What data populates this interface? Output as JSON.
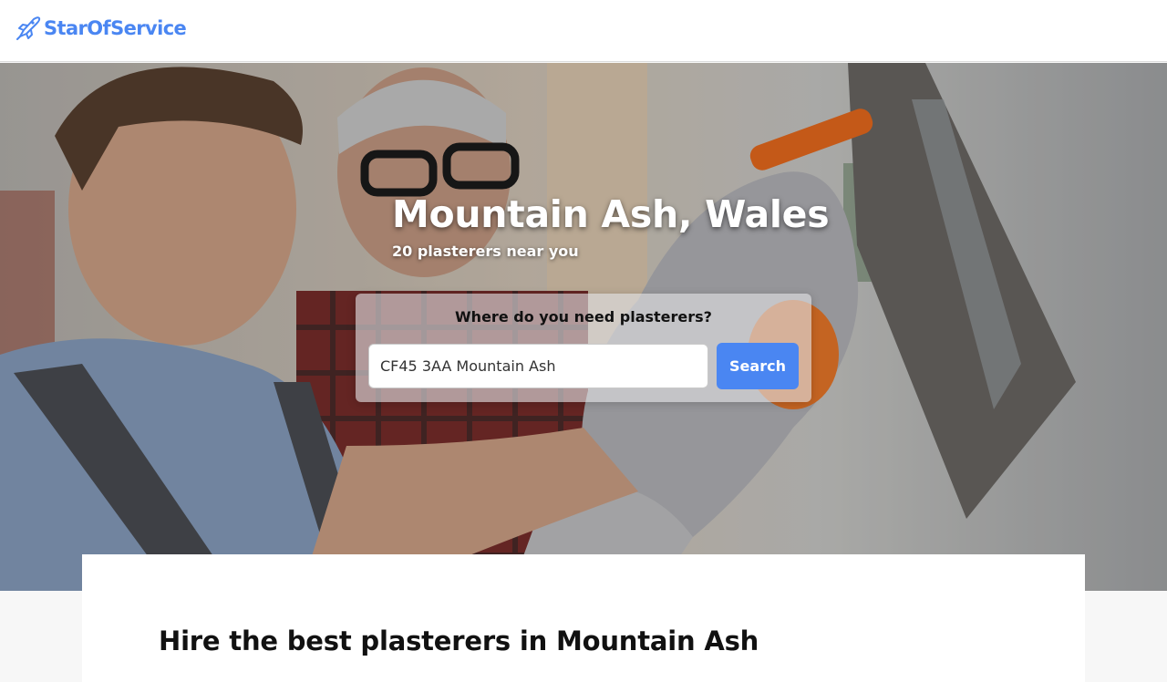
{
  "header": {
    "brand": "StarOfService",
    "brand_color": "#4a86f2",
    "logo_icon": "rocket-icon"
  },
  "hero": {
    "title": "Mountain Ash, Wales",
    "subtitle": "20 plasterers near you",
    "photo": "two plasterers working with a trowel"
  },
  "search": {
    "question": "Where do you need plasterers?",
    "input_value": "CF45 3AA Mountain Ash",
    "button_label": "Search"
  },
  "content": {
    "heading": "Hire the best plasterers in Mountain Ash"
  }
}
